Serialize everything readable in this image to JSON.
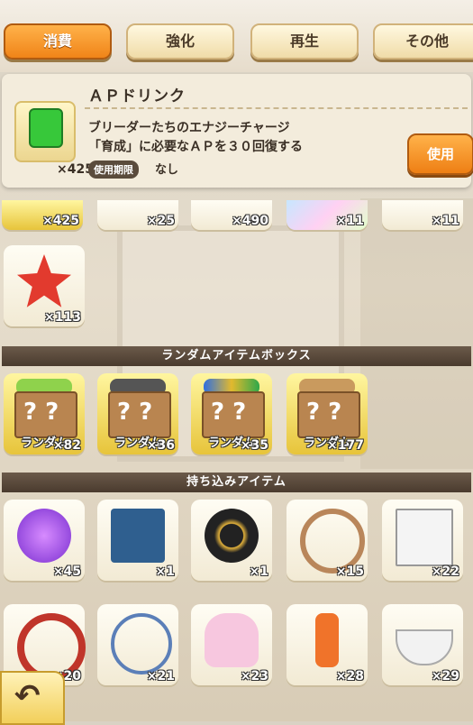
{
  "tabs": {
    "consumable": "消費",
    "enhance": "強化",
    "regen": "再生",
    "other": "その他"
  },
  "info": {
    "title": "ＡＰドリンク",
    "qty": "×425",
    "desc1": "ブリーダーたちのエナジーチャージ",
    "desc2": "「育成」に必要なＡＰを３０回復する",
    "expiry_label": "使用期限",
    "expiry_value": "なし",
    "use": "使用"
  },
  "row_top": {
    "q1": "×425",
    "q2": "×25",
    "q3": "×490",
    "q4": "×11",
    "q5": "×11"
  },
  "row_star": {
    "q1": "×113"
  },
  "section_random": "ランダムアイテムボックス",
  "random": {
    "label": "ランダム",
    "q1": "×82",
    "q2": "×36",
    "q3": "×35",
    "q4": "×177"
  },
  "section_carry": "持ち込みアイテム",
  "carry1": {
    "q1": "×45",
    "q2": "×1",
    "q3": "×1",
    "q4": "×15",
    "q5": "×22"
  },
  "carry2": {
    "q1": "×20",
    "q2": "×21",
    "q3": "×23",
    "q4": "×28",
    "q5": "×29"
  },
  "icons": {
    "back": "back-arrow-icon"
  }
}
